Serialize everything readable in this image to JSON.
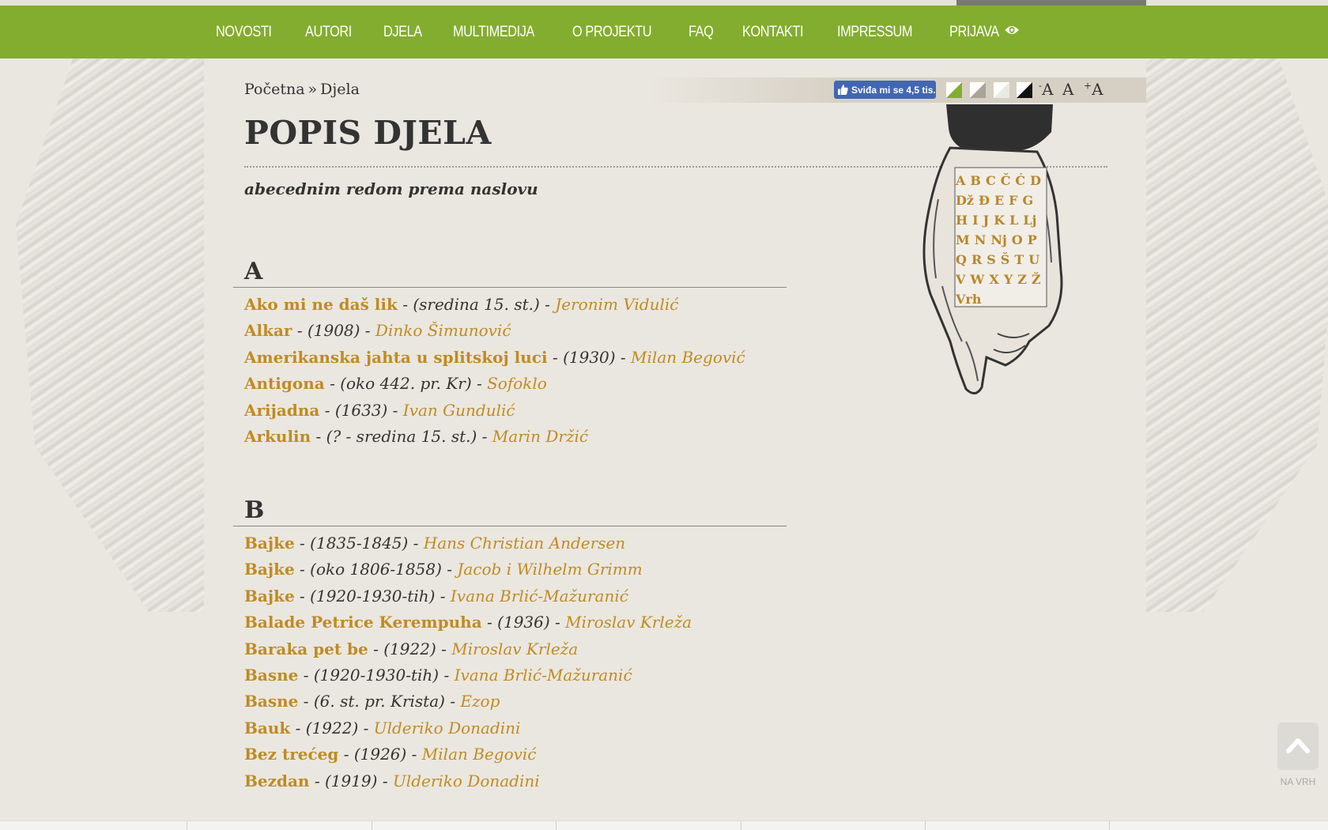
{
  "nav": {
    "items": [
      "NOVOSTI",
      "AUTORI",
      "DJELA",
      "MULTIMEDIJA",
      "O PROJEKTU",
      "FAQ",
      "KONTAKTI",
      "IMPRESSUM",
      "PRIJAVA"
    ]
  },
  "breadcrumb": {
    "home": "Početna",
    "separator": "»",
    "current": "Djela"
  },
  "facebook": {
    "like_label": "Sviđa mi se 4,5 tis."
  },
  "themes": [
    "green",
    "beige",
    "white",
    "black"
  ],
  "font_size": {
    "decrease": "A",
    "normal": "A",
    "increase": "A",
    "minus_sign": "-",
    "plus_sign": "+"
  },
  "page": {
    "title": "POPIS DJELA",
    "subtitle": "abecednim redom prema naslovu"
  },
  "alphabet": {
    "rows": [
      [
        "A",
        "B",
        "C",
        "Č",
        "Ć",
        "D"
      ],
      [
        "Dž",
        "Đ",
        "E",
        "F",
        "G"
      ],
      [
        "H",
        "I",
        "J",
        "K",
        "L",
        "Lj"
      ],
      [
        "M",
        "N",
        "Nj",
        "O",
        "P"
      ],
      [
        "Q",
        "R",
        "S",
        "Š",
        "T",
        "U"
      ],
      [
        "V",
        "W",
        "X",
        "Y",
        "Z",
        "Ž"
      ],
      [
        "Vrh"
      ]
    ]
  },
  "sections": [
    {
      "letter": "A",
      "entries": [
        {
          "title": "Ako mi ne daš lik",
          "meta": " - (sredina 15. st.) - ",
          "author": "Jeronim Vidulić"
        },
        {
          "title": "Alkar",
          "meta": " - (1908) - ",
          "author": "Dinko Šimunović"
        },
        {
          "title": "Amerikanska jahta u splitskoj luci",
          "meta": " - (1930) - ",
          "author": "Milan Begović"
        },
        {
          "title": "Antigona",
          "meta": " - (oko 442. pr. Kr) - ",
          "author": "Sofoklo"
        },
        {
          "title": "Arijadna",
          "meta": " - (1633) - ",
          "author": "Ivan Gundulić"
        },
        {
          "title": "Arkulin",
          "meta": " - (? - sredina 15. st.) - ",
          "author": "Marin Držić"
        }
      ]
    },
    {
      "letter": "B",
      "entries": [
        {
          "title": "Bajke",
          "meta": " - (1835-1845) - ",
          "author": "Hans Christian Andersen"
        },
        {
          "title": "Bajke",
          "meta": " - (oko 1806-1858) - ",
          "author": "Jacob i Wilhelm Grimm"
        },
        {
          "title": "Bajke",
          "meta": " - (1920-1930-tih) - ",
          "author": "Ivana Brlić-Mažuranić"
        },
        {
          "title": "Balade Petrice Kerempuha",
          "meta": " - (1936) - ",
          "author": "Miroslav Krleža"
        },
        {
          "title": "Baraka pet be",
          "meta": " - (1922) - ",
          "author": "Miroslav Krleža"
        },
        {
          "title": "Basne",
          "meta": " - (1920-1930-tih) - ",
          "author": "Ivana Brlić-Mažuranić"
        },
        {
          "title": "Basne",
          "meta": " - (6. st. pr. Krista) - ",
          "author": "Ezop"
        },
        {
          "title": "Bauk",
          "meta": " - (1922) - ",
          "author": "Ulderiko Donadini"
        },
        {
          "title": "Bez trećeg",
          "meta": " - (1926) - ",
          "author": "Milan Begović"
        },
        {
          "title": "Bezdan",
          "meta": " - (1919) - ",
          "author": "Ulderiko Donadini"
        }
      ]
    }
  ],
  "to_top": {
    "label": "NA VRH"
  },
  "colors": {
    "nav_bg": "#83ad2e",
    "link": "#c08b22",
    "page_bg": "#eae7e0",
    "text": "#333333"
  }
}
